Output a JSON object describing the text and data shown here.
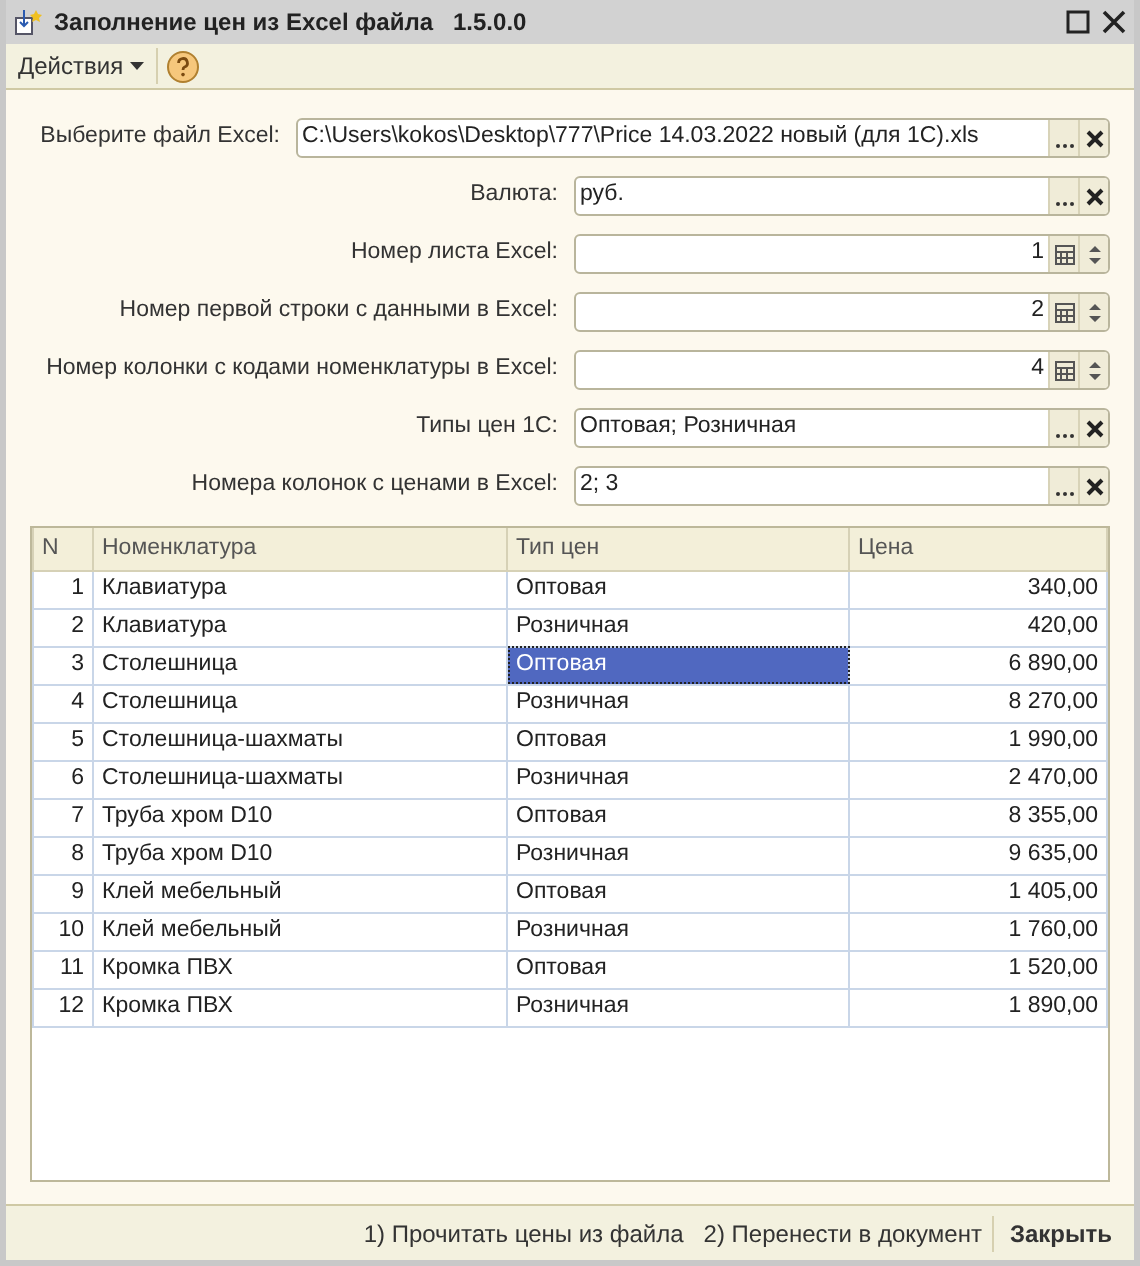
{
  "window": {
    "title": "Заполнение цен из Excel файла   1.5.0.0"
  },
  "toolbar": {
    "actions_menu": "Действия"
  },
  "fields": [
    {
      "label": "Выберите файл Excel:",
      "value": "C:\\Users\\kokos\\Desktop\\777\\Price 14.03.2022 новый (для 1С).xls",
      "kind": "choice"
    },
    {
      "label": "Валюта:",
      "value": "руб.",
      "kind": "choice"
    },
    {
      "label": "Номер листа Excel:",
      "value": "1",
      "kind": "number"
    },
    {
      "label": "Номер первой строки с данными в Excel:",
      "value": "2",
      "kind": "number"
    },
    {
      "label": "Номер колонки с кодами номенклатуры в Excel:",
      "value": "4",
      "kind": "number"
    },
    {
      "label": "Типы цен 1С:",
      "value": "Оптовая; Розничная",
      "kind": "choice"
    },
    {
      "label": "Номера колонок с ценами в Excel:",
      "value": "2; 3",
      "kind": "choice"
    }
  ],
  "table": {
    "columns": [
      "N",
      "Номенклатура",
      "Тип цен",
      "Цена"
    ],
    "rows": [
      {
        "n": "1",
        "item": "Клавиатура",
        "price_type": "Оптовая",
        "price": "340,00",
        "price_type_selected": false
      },
      {
        "n": "2",
        "item": "Клавиатура",
        "price_type": "Розничная",
        "price": "420,00",
        "price_type_selected": false
      },
      {
        "n": "3",
        "item": "Столешница",
        "price_type": "Оптовая",
        "price": "6 890,00",
        "price_type_selected": true
      },
      {
        "n": "4",
        "item": "Столешница",
        "price_type": "Розничная",
        "price": "8 270,00",
        "price_type_selected": false
      },
      {
        "n": "5",
        "item": "Столешница-шахматы",
        "price_type": "Оптовая",
        "price": "1 990,00",
        "price_type_selected": false
      },
      {
        "n": "6",
        "item": "Столешница-шахматы",
        "price_type": "Розничная",
        "price": "2 470,00",
        "price_type_selected": false
      },
      {
        "n": "7",
        "item": "Труба хром D10",
        "price_type": "Оптовая",
        "price": "8 355,00",
        "price_type_selected": false
      },
      {
        "n": "8",
        "item": "Труба хром D10",
        "price_type": "Розничная",
        "price": "9 635,00",
        "price_type_selected": false
      },
      {
        "n": "9",
        "item": "Клей мебельный",
        "price_type": "Оптовая",
        "price": "1 405,00",
        "price_type_selected": false
      },
      {
        "n": "10",
        "item": "Клей мебельный",
        "price_type": "Розничная",
        "price": "1 760,00",
        "price_type_selected": false
      },
      {
        "n": "11",
        "item": "Кромка ПВХ",
        "price_type": "Оптовая",
        "price": "1 520,00",
        "price_type_selected": false
      },
      {
        "n": "12",
        "item": "Кромка ПВХ",
        "price_type": "Розничная",
        "price": "1 890,00",
        "price_type_selected": false
      }
    ]
  },
  "footer": {
    "buttons": [
      {
        "label": "1) Прочитать цены из файла",
        "kind": "normal"
      },
      {
        "label": "2) Перенести в документ",
        "kind": "normal"
      },
      {
        "label": "Закрыть",
        "kind": "default"
      }
    ]
  }
}
